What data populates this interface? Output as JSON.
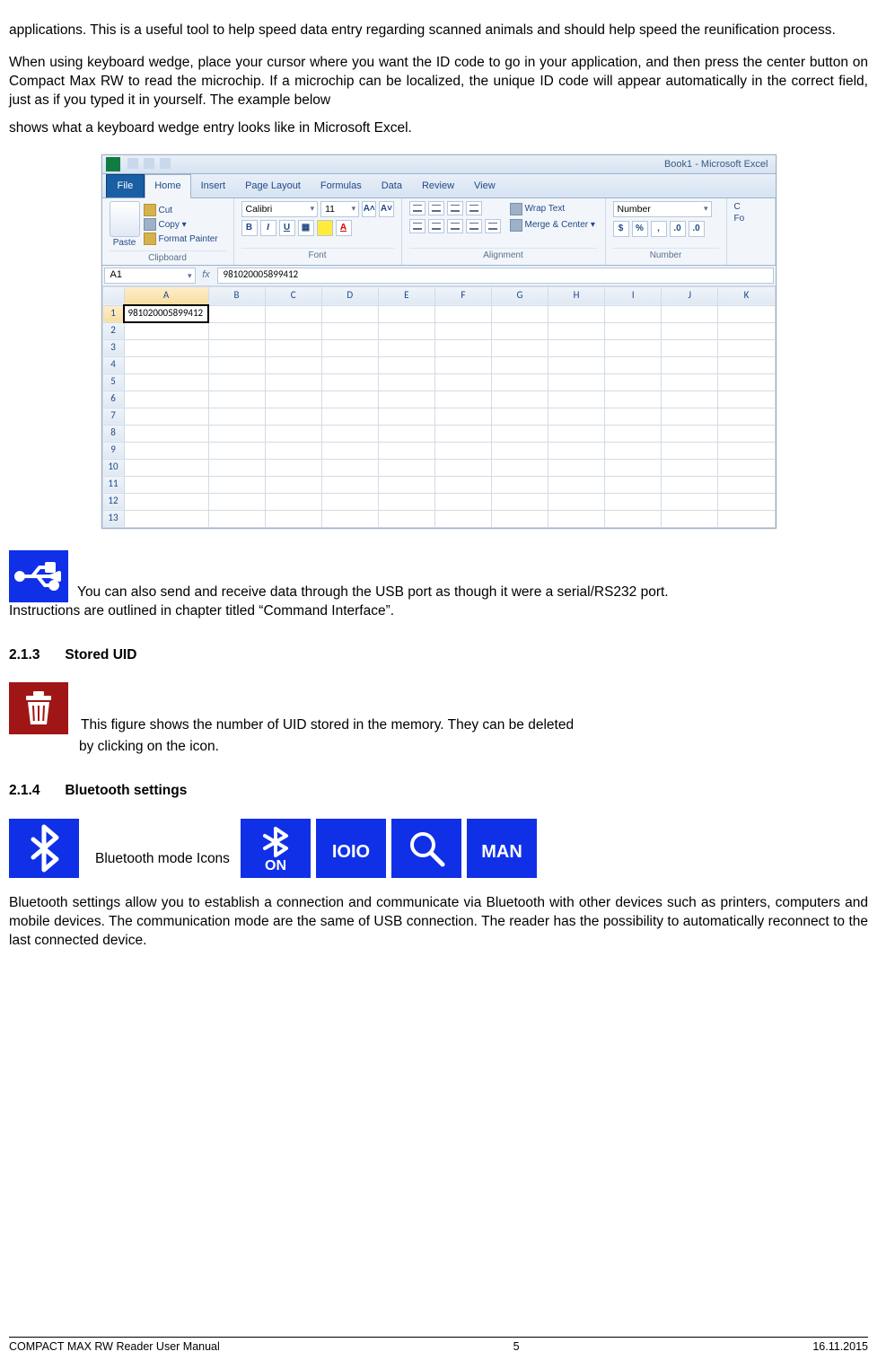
{
  "intro": {
    "p1": "applications. This is a useful tool to help speed data entry regarding scanned animals and should help speed the reunification process.",
    "p2": "When using keyboard wedge, place your cursor where you want the ID code to go in your application, and then press the center button on Compact Max RW to read the microchip. If a microchip can be localized, the unique ID code will appear automatically in the correct field, just as if you typed it in yourself. The example below",
    "p2b": "shows what a keyboard wedge entry looks like in Microsoft Excel."
  },
  "excel": {
    "title": "Book1 - Microsoft Excel",
    "file_tab": "File",
    "tabs": [
      "Home",
      "Insert",
      "Page Layout",
      "Formulas",
      "Data",
      "Review",
      "View"
    ],
    "clipboard": {
      "group_label": "Clipboard",
      "paste_label": "Paste",
      "cut": "Cut",
      "copy": "Copy ▾",
      "format_painter": "Format Painter"
    },
    "font": {
      "group_label": "Font",
      "name": "Calibri",
      "size": "11",
      "grow": "A˄",
      "shrink": "A˅",
      "bold": "B",
      "italic": "I",
      "underline": "U",
      "border_caret": "▾",
      "fill_caret": "▾",
      "color": "A"
    },
    "alignment": {
      "group_label": "Alignment",
      "wrap": "Wrap Text",
      "merge": "Merge & Center ▾"
    },
    "number": {
      "group_label": "Number",
      "format": "Number",
      "extra": "Fo"
    },
    "namebox": "A1",
    "fx_label": "fx",
    "formula_value": "981020005899412",
    "cell_a1": "981020005899412",
    "cols": [
      "A",
      "B",
      "C",
      "D",
      "E",
      "F",
      "G",
      "H",
      "I",
      "J",
      "K"
    ],
    "row_numbers": [
      "1",
      "2",
      "3",
      "4",
      "5",
      "6",
      "7",
      "8",
      "9",
      "10",
      "11",
      "12",
      "13"
    ]
  },
  "usb_note": {
    "line1": " You can also send and receive data through the USB port as though it were a serial/RS232 port.",
    "line2": "Instructions are outlined in chapter titled “Command Interface”."
  },
  "headings": {
    "stored": {
      "num": "2.1.3",
      "title": "Stored UID"
    },
    "bt": {
      "num": "2.1.4",
      "title": "Bluetooth settings"
    }
  },
  "stored": {
    "p_part1": "This figure shows the number of UID stored in the memory. They can be deleted",
    "p_part2": "by clicking on the icon."
  },
  "bt": {
    "label": "Bluetooth mode Icons",
    "on_label": "ON",
    "ioio": "IOIO",
    "man": "MAN",
    "desc": "Bluetooth settings allow you to establish a connection and communicate via Bluetooth with other devices such as printers, computers and mobile devices. The communication mode are the same of USB connection. The reader has the possibility to automatically reconnect to the last connected device."
  },
  "footer": {
    "left": "COMPACT MAX RW Reader User Manual",
    "center": "5",
    "right": "16.11.2015"
  }
}
